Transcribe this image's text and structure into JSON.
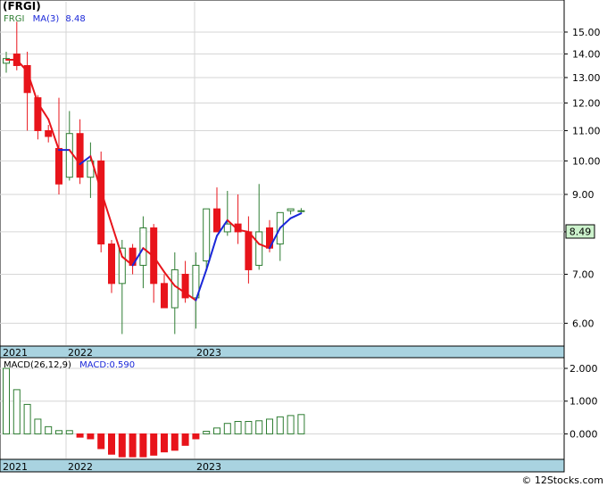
{
  "ticker_title": "(FRGI)",
  "watermark": "© 12Stocks.com",
  "colors": {
    "up": "#2e7d32",
    "down": "#e8141b",
    "ma_up": "#1a27d9",
    "ma_down": "#e8141b",
    "macd_up": "#2e7d32",
    "macd_down": "#e8141b",
    "date_band": "#a9d3e0",
    "last_label_bg": "#ccf2cc",
    "grid": "#d6d6d6"
  },
  "chart_data": [
    {
      "type": "candlestick",
      "legend": {
        "symbol": "FRGI",
        "ma_label": "MA(3)",
        "ma_value": "8.48"
      },
      "y_scale": "log",
      "ylim": [
        5.6,
        16.5
      ],
      "y_ticks": [
        "6.00",
        "7.00",
        "8.00",
        "9.00",
        "10.00",
        "11.00",
        "12.00",
        "13.00",
        "14.00",
        "15.00"
      ],
      "x_tick_labels": [
        "2021",
        "2022",
        "2023"
      ],
      "last_value_label": "8.49",
      "grid": true,
      "candles": [
        {
          "open": 13.6,
          "high": 14.1,
          "low": 13.2,
          "close": 13.8
        },
        {
          "open": 14.0,
          "high": 15.5,
          "low": 13.3,
          "close": 13.5
        },
        {
          "open": 13.5,
          "high": 14.1,
          "low": 11.0,
          "close": 12.4
        },
        {
          "open": 12.2,
          "high": 12.3,
          "low": 10.7,
          "close": 11.0
        },
        {
          "open": 11.0,
          "high": 11.2,
          "low": 10.6,
          "close": 10.8
        },
        {
          "open": 10.4,
          "high": 12.2,
          "low": 9.0,
          "close": 9.3
        },
        {
          "open": 9.5,
          "high": 11.7,
          "low": 9.4,
          "close": 10.9
        },
        {
          "open": 10.9,
          "high": 11.4,
          "low": 9.3,
          "close": 9.5
        },
        {
          "open": 9.5,
          "high": 10.6,
          "low": 8.9,
          "close": 10.0
        },
        {
          "open": 10.0,
          "high": 10.3,
          "low": 7.5,
          "close": 7.7
        },
        {
          "open": 7.7,
          "high": 7.8,
          "low": 6.6,
          "close": 6.8
        },
        {
          "open": 6.8,
          "high": 7.8,
          "low": 5.8,
          "close": 7.6
        },
        {
          "open": 7.6,
          "high": 7.7,
          "low": 7.0,
          "close": 7.2
        },
        {
          "open": 7.2,
          "high": 8.4,
          "low": 6.7,
          "close": 8.1
        },
        {
          "open": 8.1,
          "high": 8.2,
          "low": 6.4,
          "close": 6.8
        },
        {
          "open": 6.8,
          "high": 7.0,
          "low": 6.3,
          "close": 6.3
        },
        {
          "open": 6.3,
          "high": 7.5,
          "low": 5.8,
          "close": 7.1
        },
        {
          "open": 7.0,
          "high": 7.3,
          "low": 6.4,
          "close": 6.5
        },
        {
          "open": 6.5,
          "high": 7.5,
          "low": 5.9,
          "close": 7.2
        },
        {
          "open": 7.3,
          "high": 8.5,
          "low": 7.1,
          "close": 8.6
        },
        {
          "open": 8.6,
          "high": 9.2,
          "low": 8.0,
          "close": 8.0
        },
        {
          "open": 8.0,
          "high": 9.1,
          "low": 7.9,
          "close": 8.2
        },
        {
          "open": 8.2,
          "high": 9.0,
          "low": 7.7,
          "close": 8.0
        },
        {
          "open": 8.0,
          "high": 8.4,
          "low": 6.8,
          "close": 7.1
        },
        {
          "open": 7.2,
          "high": 9.3,
          "low": 7.1,
          "close": 8.0
        },
        {
          "open": 8.1,
          "high": 8.3,
          "low": 7.5,
          "close": 7.6
        },
        {
          "open": 7.7,
          "high": 8.5,
          "low": 7.3,
          "close": 8.5
        },
        {
          "open": 8.55,
          "high": 8.6,
          "low": 8.45,
          "close": 8.6
        },
        {
          "open": 8.55,
          "high": 8.62,
          "low": 8.5,
          "close": 8.55
        }
      ],
      "ma3": [
        13.75,
        13.75,
        13.25,
        12.0,
        11.4,
        10.35,
        10.35,
        9.9,
        10.15,
        9.1,
        8.2,
        7.4,
        7.2,
        7.6,
        7.4,
        7.05,
        6.75,
        6.6,
        6.45,
        7.1,
        7.9,
        8.3,
        8.05,
        8.0,
        7.7,
        7.6,
        8.1,
        8.35,
        8.48
      ],
      "ma3_colors": [
        "down",
        "down",
        "down",
        "down",
        "down",
        "down",
        "up",
        "down",
        "up",
        "down",
        "down",
        "down",
        "down",
        "up",
        "down",
        "down",
        "down",
        "down",
        "down",
        "up",
        "up",
        "up",
        "down",
        "down",
        "down",
        "down",
        "up",
        "up",
        "up"
      ]
    },
    {
      "type": "bar",
      "legend": {
        "name": "MACD(26,12,9)",
        "value_label": "MACD:0.590"
      },
      "ylim": [
        -0.75,
        2.3
      ],
      "y_ticks": [
        "2.000",
        "1.000",
        "0.000"
      ],
      "x_tick_labels": [
        "2021",
        "2022",
        "2023"
      ],
      "values": [
        2.0,
        1.35,
        0.9,
        0.45,
        0.22,
        0.1,
        0.1,
        -0.1,
        -0.15,
        -0.45,
        -0.62,
        -0.7,
        -0.7,
        -0.7,
        -0.65,
        -0.55,
        -0.5,
        -0.35,
        -0.15,
        0.08,
        0.18,
        0.32,
        0.38,
        0.38,
        0.4,
        0.45,
        0.52,
        0.56,
        0.59
      ]
    }
  ]
}
